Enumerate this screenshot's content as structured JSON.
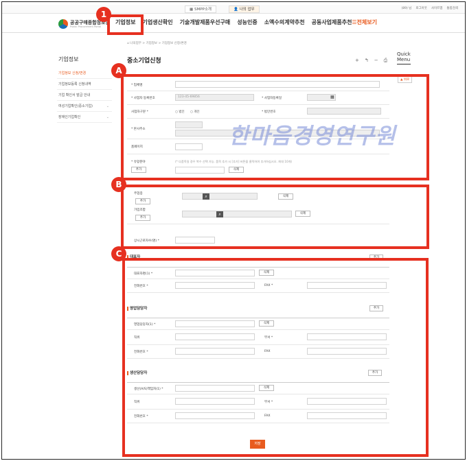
{
  "topbar": {
    "tab1": "SMPP소개",
    "tab2": "나의 업무",
    "util": [
      "(89) 님",
      "로그아웃",
      "사이트맵",
      "통합검색"
    ]
  },
  "logo": {
    "name": "공공구매종합정보망",
    "sub": "Public Procurement Portal"
  },
  "gnb": [
    "기업정보",
    "기업생산확인",
    "기술개발제품우선구매",
    "성능인증",
    "소액수의계약추천",
    "공동사업제품추천"
  ],
  "allmenu": "전체보기",
  "breadcrumb": "나의업무 > 기업정보 > 기업정보 신청/변경",
  "lnb": {
    "title": "기업정보",
    "items": [
      {
        "label": "기업정보 신청/변경",
        "arrow": ""
      },
      {
        "label": "기업정보등록 신청내역",
        "arrow": ""
      },
      {
        "label": "기업 확인서 발급 안내",
        "arrow": ""
      },
      {
        "label": "여성기업확인(중소기업)",
        "arrow": "⌄"
      },
      {
        "label": "장애인기업확인",
        "arrow": "⌄"
      }
    ]
  },
  "page_title": "중소기업신청",
  "tools": [
    "+",
    "↰",
    "−",
    "⎙"
  ],
  "quick": {
    "line1": "Quick",
    "line2": "Menu",
    "up": "▲ 위로"
  },
  "watermark": "한마음경영연구원",
  "badges": {
    "n1": "1",
    "a": "A",
    "b": "B",
    "c": "C"
  },
  "form_a": {
    "company_name": "* 업체명",
    "biz_no": "* 사업자 등록번호",
    "biz_no_value": "123-45-69856",
    "biz_reg_date": "* 사업자등록일",
    "biz_type": "사업자구분 *",
    "corp_option": "법인",
    "personal_option": "개인",
    "corp_no": "* 법인번호",
    "hq_address": "* 본사주소",
    "homepage": "홈페이지",
    "product": "* 유망분야",
    "product_hint": "(* 다품목일 경우 복수 선택 가능. 품목 추가 시 [추가] 버튼을 클릭하여 추가하십시오. 최대 10개)",
    "add": "추가",
    "delete": "삭제"
  },
  "form_b": {
    "main_biz": "주업종",
    "add": "추가",
    "delete": "삭제",
    "union": "가입조합",
    "employees": "상시근로자수(명) *"
  },
  "form_c": {
    "rep_title": "대표자",
    "add": "추가",
    "rep_name": "대표자명(1) *",
    "delete": "삭제",
    "phone": "전화번호 *",
    "fax_req": "FAX *",
    "sales_title": "영업담당자",
    "sales_name": "영업담당자(1) *",
    "position": "직위",
    "dept": "부서 *",
    "phone2": "전화번호 *",
    "fax": "FAX",
    "prod_title": "생산담당자",
    "prod_name": "생산(A/S)책임자(1) *",
    "position2": "직위",
    "dept2": "부서 *",
    "phone3": "전화번호 *",
    "fax2": "FAX"
  },
  "save": "저장",
  "colors": {
    "accent": "#e85b1f",
    "annotation": "#e63020"
  }
}
